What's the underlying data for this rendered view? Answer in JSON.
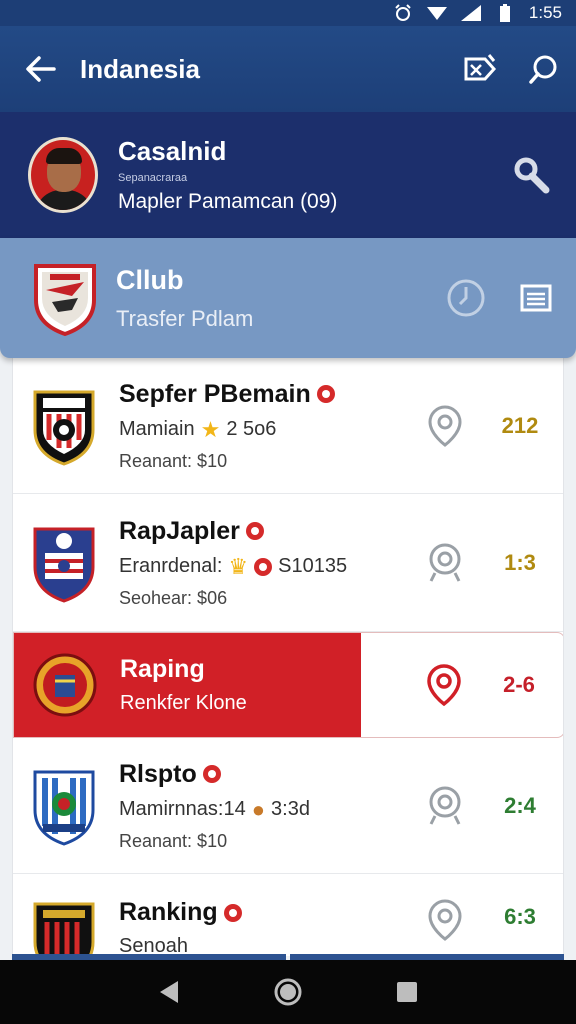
{
  "status_bar": {
    "time": "1:55",
    "icons": [
      "alarm-icon",
      "wifi-icon",
      "signal-icon",
      "battery-icon"
    ]
  },
  "app_bar": {
    "title": "Indanesia",
    "actions": [
      "tag-icon",
      "search-icon"
    ]
  },
  "profile": {
    "name": "Casalnid",
    "subtitle": "Sepanacraraa",
    "detail": "Mapler Pamamcan (09)"
  },
  "club": {
    "name": "Cllub",
    "subtitle": "Trasfer Pdlam"
  },
  "rows": [
    {
      "title": "Sepfer PBemain",
      "line2_text": "Mamiain",
      "line2_value": "2 5o6",
      "line3": "Reanant: $10",
      "score": "212",
      "score_color": "#b08a10"
    },
    {
      "title": "RapJapler",
      "line2_text": "Eranrdenal:",
      "line2_value": "S10135",
      "line3": "Seohear: $06",
      "score": "1:3",
      "score_color": "#b08a10"
    },
    {
      "title": "Raping",
      "line2_text": "Renkfer Klone",
      "line2_value": "",
      "line3": "",
      "score": "2-6",
      "score_color": "#c5202a"
    },
    {
      "title": "Rlspto",
      "line2_text": "Mamirnnas:14",
      "line2_value": "3:3d",
      "line3": "Reanant: $10",
      "score": "2:4",
      "score_color": "#2e7d32"
    },
    {
      "title": "Ranking",
      "line2_text": "Senoah",
      "line2_value": "",
      "line3": "",
      "score": "6:3",
      "score_color": "#2e7d32"
    }
  ],
  "nav": [
    "back-nav-icon",
    "home-nav-icon",
    "recents-nav-icon"
  ]
}
